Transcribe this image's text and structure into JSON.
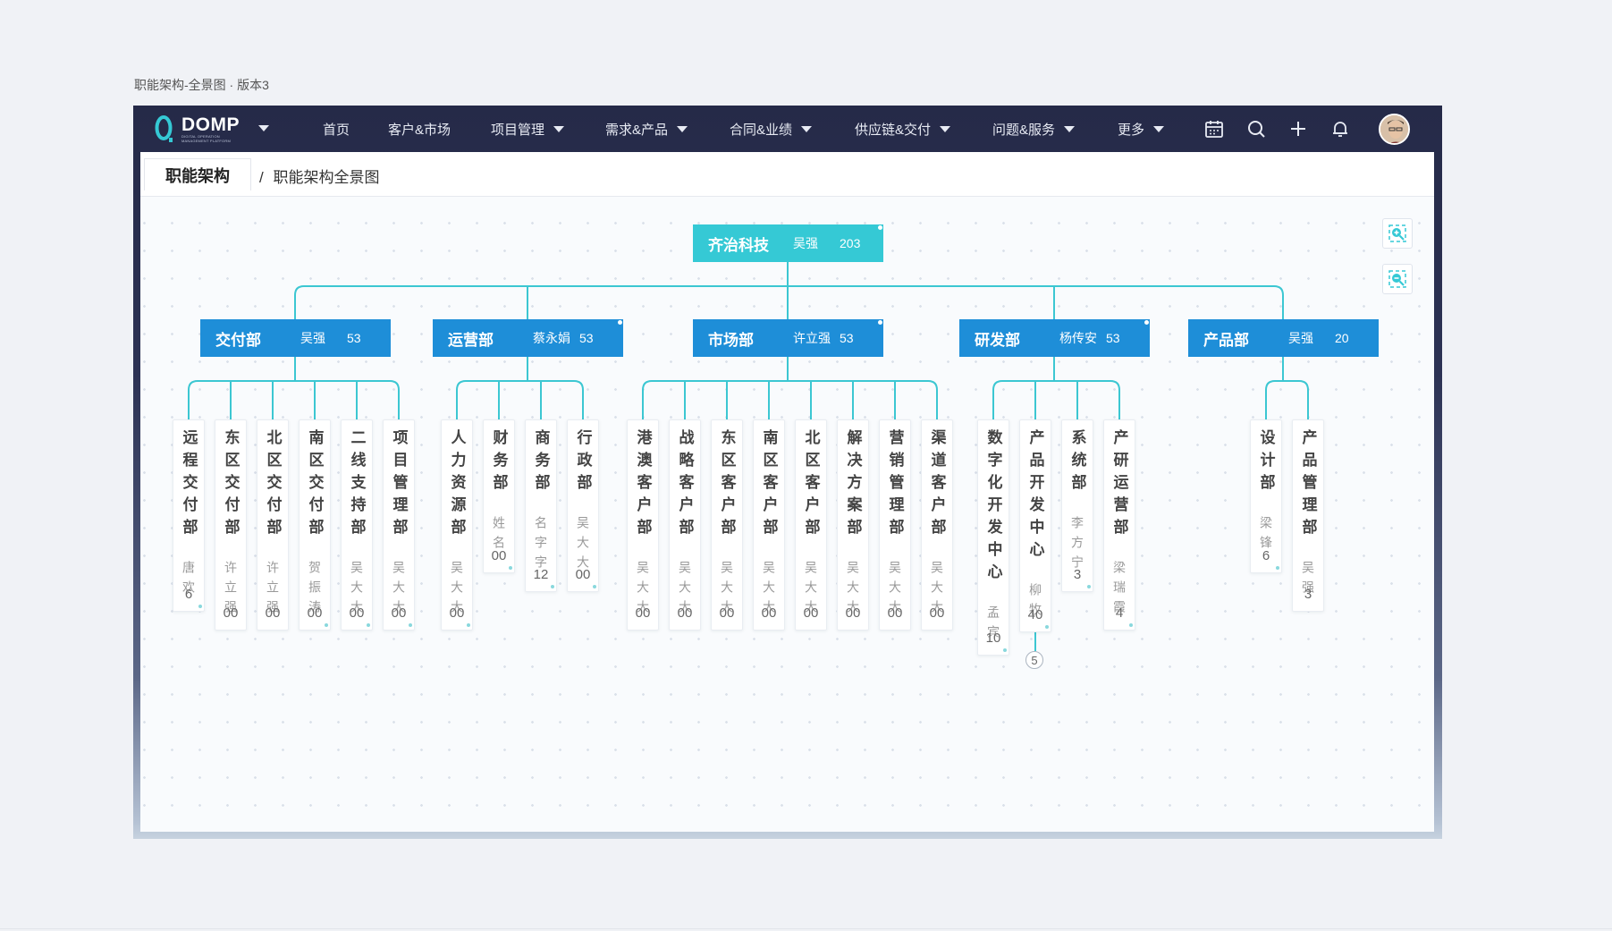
{
  "page_caption": "职能架构-全景图 · 版本3",
  "app": {
    "logo_text": "DOMP",
    "logo_subtitle": "DIGITAL OPERATION MANAGEMENT PLATFORM",
    "brand_color": "#35c9d5"
  },
  "nav": {
    "items": [
      {
        "label": "首页",
        "has_dropdown": false
      },
      {
        "label": "客户&市场",
        "has_dropdown": false
      },
      {
        "label": "项目管理",
        "has_dropdown": true
      },
      {
        "label": "需求&产品",
        "has_dropdown": true
      },
      {
        "label": "合同&业绩",
        "has_dropdown": true
      },
      {
        "label": "供应链&交付",
        "has_dropdown": true
      },
      {
        "label": "问题&服务",
        "has_dropdown": true
      },
      {
        "label": "更多",
        "has_dropdown": true
      }
    ],
    "icons": [
      "calendar-icon",
      "search-icon",
      "plus-icon",
      "bell-icon"
    ]
  },
  "breadcrumb": {
    "parent": "职能架构",
    "separator": "/",
    "current": "职能架构全景图"
  },
  "colors": {
    "root_node": "#35c9d5",
    "dept_node": "#1e8ed8",
    "connector": "#3cc7d2"
  },
  "org": {
    "root": {
      "name": "齐治科技",
      "lead": "吴强",
      "count": "203"
    },
    "departments": [
      {
        "name": "交付部",
        "lead": "吴强",
        "count": "53",
        "children": [
          {
            "name": "远程交付部",
            "lead": "唐欢",
            "count": "6"
          },
          {
            "name": "东区交付部",
            "lead": "许立强",
            "count": "00"
          },
          {
            "name": "北区交付部",
            "lead": "许立强",
            "count": "00"
          },
          {
            "name": "南区交付部",
            "lead": "贺振涛",
            "count": "00"
          },
          {
            "name": "二线支持部",
            "lead": "吴大大",
            "count": "00"
          },
          {
            "name": "项目管理部",
            "lead": "吴大大",
            "count": "00"
          }
        ]
      },
      {
        "name": "运营部",
        "lead": "蔡永娟",
        "count": "53",
        "children": [
          {
            "name": "人力资源部",
            "lead": "吴大大",
            "count": "00"
          },
          {
            "name": "财务部",
            "lead": "姓名",
            "count": "00"
          },
          {
            "name": "商务部",
            "lead": "名字字",
            "count": "12"
          },
          {
            "name": "行政部",
            "lead": "吴大大",
            "count": "00"
          }
        ]
      },
      {
        "name": "市场部",
        "lead": "许立强",
        "count": "53",
        "children": [
          {
            "name": "港澳客户部",
            "lead": "吴大大",
            "count": "00"
          },
          {
            "name": "战略客户部",
            "lead": "吴大大",
            "count": "00"
          },
          {
            "name": "东区客户部",
            "lead": "吴大大",
            "count": "00"
          },
          {
            "name": "南区客户部",
            "lead": "吴大大",
            "count": "00"
          },
          {
            "name": "北区客户部",
            "lead": "吴大大",
            "count": "00"
          },
          {
            "name": "解决方案部",
            "lead": "吴大大",
            "count": "00"
          },
          {
            "name": "营销管理部",
            "lead": "吴大大",
            "count": "00"
          },
          {
            "name": "渠道客户部",
            "lead": "吴大大",
            "count": "00"
          }
        ]
      },
      {
        "name": "研发部",
        "lead": "杨传安",
        "count": "53",
        "children": [
          {
            "name": "数字化开发中心",
            "lead": "孟宾",
            "count": "10"
          },
          {
            "name": "产品开发中心",
            "lead": "柳牧",
            "count": "40",
            "collapsed_children": "5"
          },
          {
            "name": "系统部",
            "lead": "李方宁",
            "count": "3"
          },
          {
            "name": "产研运营部",
            "lead": "梁瑞霞",
            "count": "4"
          }
        ]
      },
      {
        "name": "产品部",
        "lead": "吴强",
        "count": "20",
        "children": [
          {
            "name": "设计部",
            "lead": "梁锋",
            "count": "6"
          },
          {
            "name": "产品管理部",
            "lead": "吴强",
            "count": "3"
          }
        ]
      }
    ]
  }
}
